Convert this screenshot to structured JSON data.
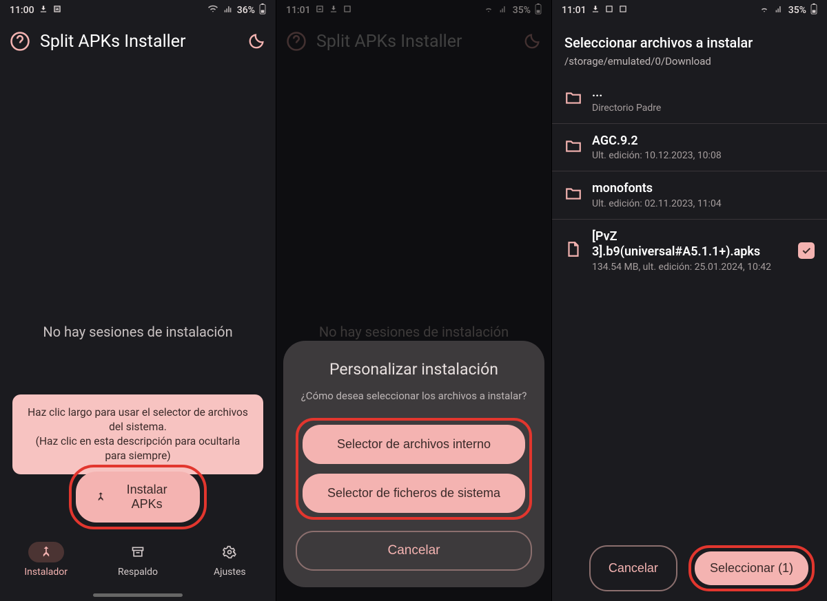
{
  "colors": {
    "accent": "#f4b3b1",
    "highlight": "#e2362e",
    "bg": "#1b1b1f"
  },
  "screen1": {
    "status": {
      "time": "11:00",
      "battery": "36%"
    },
    "header": {
      "title": "Split APKs Installer"
    },
    "empty_text": "No hay sesiones de instalación",
    "tooltip_line1": "Haz clic largo para usar el selector de archivos del sistema.",
    "tooltip_line2": "(Haz clic en esta descripción para ocultarla para siempre)",
    "install_label": "Instalar APKs",
    "nav": {
      "installer": "Instalador",
      "backup": "Respaldo",
      "settings": "Ajustes"
    }
  },
  "screen2": {
    "status": {
      "time": "11:01",
      "battery": "35%"
    },
    "header": {
      "title": "Split APKs Installer"
    },
    "empty_text": "No hay sesiones de instalación",
    "dialog": {
      "title": "Personalizar instalación",
      "subtitle": "¿Cómo desea seleccionar los archivos a instalar?",
      "option_internal": "Selector de archivos interno",
      "option_system": "Selector de ficheros de sistema",
      "cancel": "Cancelar"
    }
  },
  "screen3": {
    "status": {
      "time": "11:01",
      "battery": "35%"
    },
    "picker": {
      "title": "Seleccionar archivos a instalar",
      "path": "/storage/emulated/0/Download",
      "rows": [
        {
          "name": "...",
          "meta": "Directorio Padre",
          "type": "folder"
        },
        {
          "name": "AGC.9.2",
          "meta": "Ult. edición: 10.12.2023, 10:08",
          "type": "folder"
        },
        {
          "name": "monofonts",
          "meta": "Ult. edición: 02.11.2023, 11:04",
          "type": "folder"
        },
        {
          "name": "[PvZ 3].b9(universal#A5.1.1+).apks",
          "meta": "134.54 MB, ult. edición: 25.01.2024, 10:42",
          "type": "file",
          "checked": true
        }
      ],
      "cancel": "Cancelar",
      "select": "Seleccionar (1)"
    }
  }
}
